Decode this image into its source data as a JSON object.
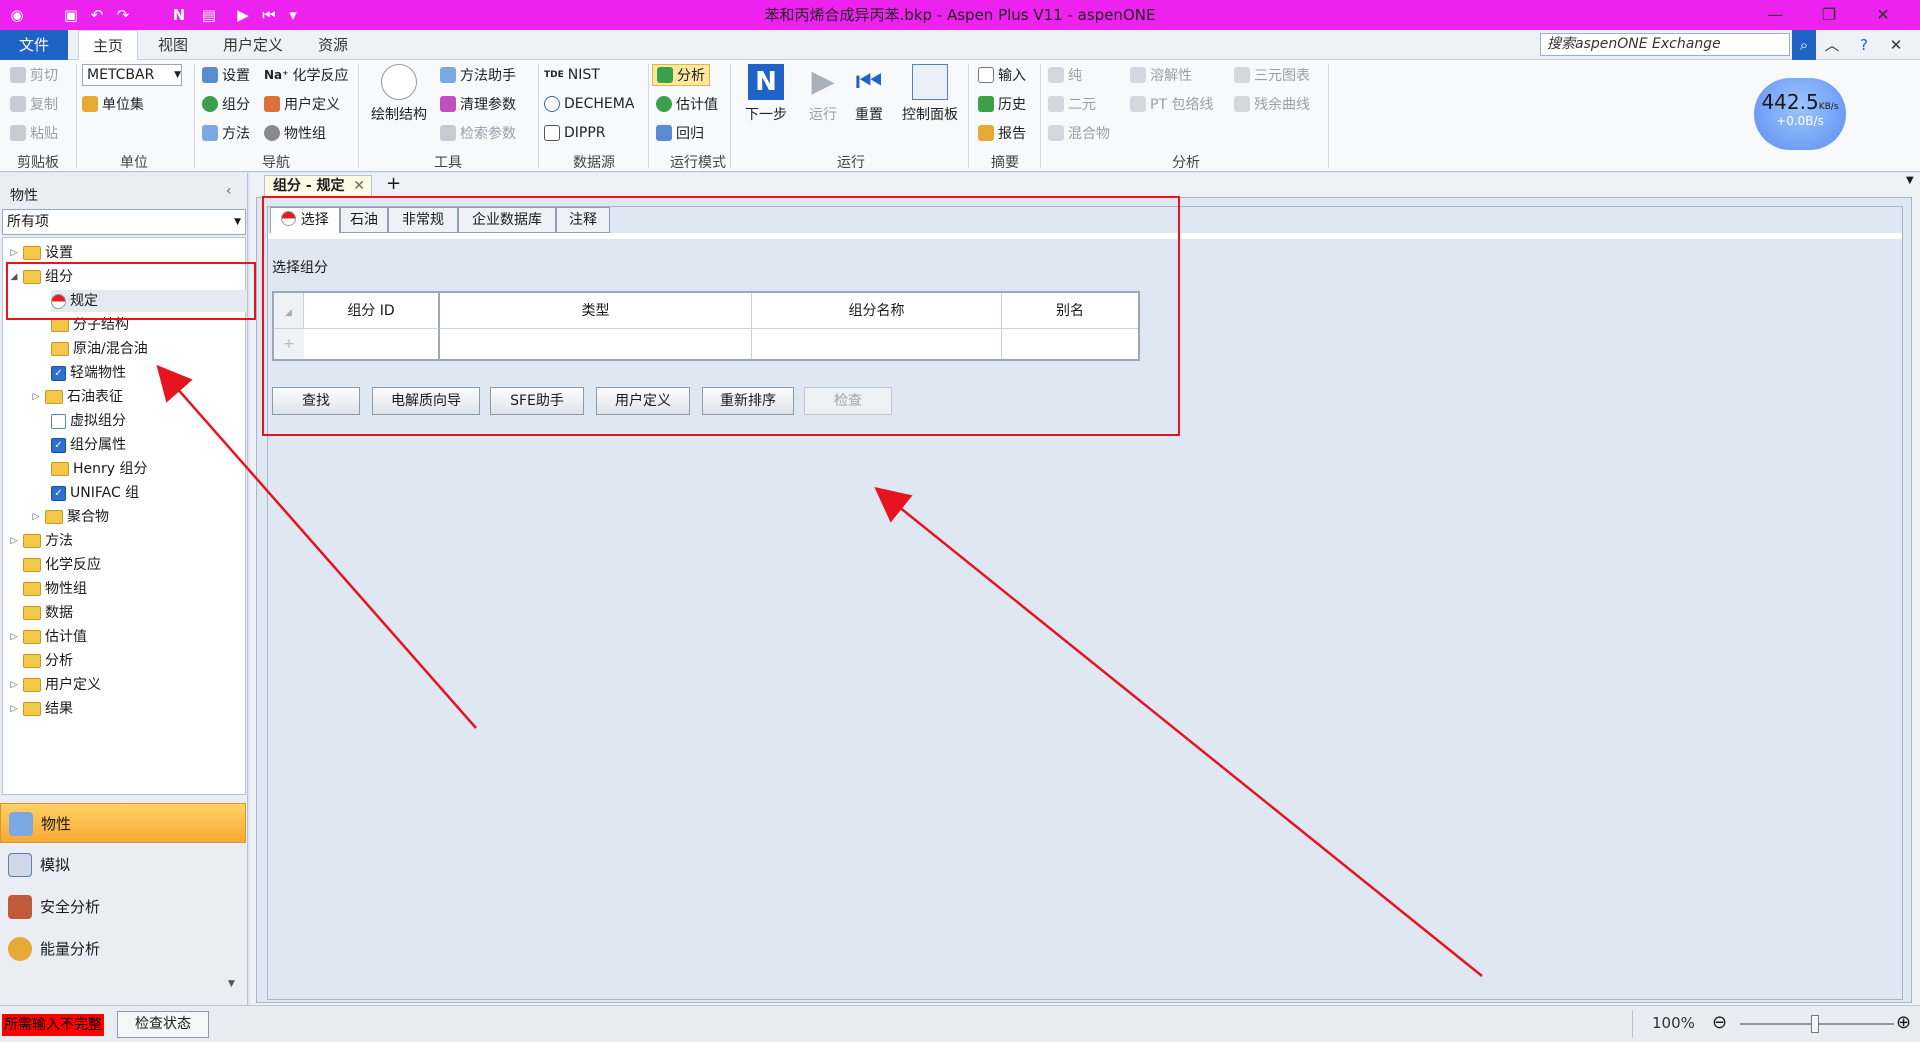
{
  "titlebar": {
    "title": "苯和丙烯合成异丙苯.bkp - Aspen Plus V11 - aspenONE",
    "colors": {
      "bg": "#ee22ee"
    }
  },
  "menu": {
    "file": "文件",
    "tabs": [
      "主页",
      "视图",
      "用户定义",
      "资源"
    ],
    "active_tab": "主页",
    "search_placeholder": "搜索aspenONE Exchange"
  },
  "ribbon": {
    "clipboard": {
      "cut": "剪切",
      "copy": "复制",
      "paste": "粘贴",
      "group": "剪贴板"
    },
    "units": {
      "select": "METCBAR",
      "unitset": "单位集",
      "group": "单位"
    },
    "nav": {
      "setup": "设置",
      "components": "组分",
      "methods": "方法",
      "chem": "化学反应",
      "custom": "用户定义",
      "propset": "物性组",
      "group": "导航"
    },
    "tools": {
      "draw": "绘制结构",
      "method_asst": "方法助手",
      "clean": "清理参数",
      "retrieve": "检索参数",
      "group": "工具"
    },
    "datasource": {
      "nist": "NIST",
      "dechema": "DECHEMA",
      "dippr": "DIPPR",
      "group": "数据源"
    },
    "runmode": {
      "analysis": "分析",
      "estimate": "估计值",
      "regress": "回归",
      "group": "运行模式"
    },
    "run": {
      "next": "下一步",
      "run": "运行",
      "reset": "重置",
      "control": "控制面板",
      "group": "运行"
    },
    "summary": {
      "input": "输入",
      "history": "历史",
      "report": "报告",
      "group": "摘要"
    },
    "analysis": {
      "pure": "纯",
      "binary": "二元",
      "mixture": "混合物",
      "solubility": "溶解性",
      "pt": "PT 包络线",
      "ternary": "三元图表",
      "residue": "残余曲线",
      "group": "分析"
    }
  },
  "netspeed": {
    "value": "442.5",
    "unit": "KB/s",
    "up": "+0.0B/s"
  },
  "left": {
    "header": "物性",
    "filter": "所有项",
    "tree": [
      {
        "label": "设置"
      },
      {
        "label": "组分"
      },
      {
        "label": "规定"
      },
      {
        "label": "分子结构"
      },
      {
        "label": "原油/混合油"
      },
      {
        "label": "轻端物性"
      },
      {
        "label": "石油表征"
      },
      {
        "label": "虚拟组分"
      },
      {
        "label": "组分属性"
      },
      {
        "label": "Henry 组分"
      },
      {
        "label": "UNIFAC 组"
      },
      {
        "label": "聚合物"
      },
      {
        "label": "方法"
      },
      {
        "label": "化学反应"
      },
      {
        "label": "物性组"
      },
      {
        "label": "数据"
      },
      {
        "label": "估计值"
      },
      {
        "label": "分析"
      },
      {
        "label": "用户定义"
      },
      {
        "label": "结果"
      }
    ],
    "nav": [
      "物性",
      "模拟",
      "安全分析",
      "能量分析"
    ]
  },
  "doc": {
    "tab": "组分 - 规定",
    "subtabs": [
      "选择",
      "石油",
      "非常规",
      "企业数据库",
      "注释"
    ],
    "section": "选择组分",
    "columns": [
      "组分 ID",
      "类型",
      "组分名称",
      "别名"
    ],
    "buttons": [
      "查找",
      "电解质向导",
      "SFE助手",
      "用户定义",
      "重新排序",
      "检查"
    ]
  },
  "status": {
    "warning": "所需输入不完整",
    "check": "检查状态",
    "zoom": "100%"
  }
}
